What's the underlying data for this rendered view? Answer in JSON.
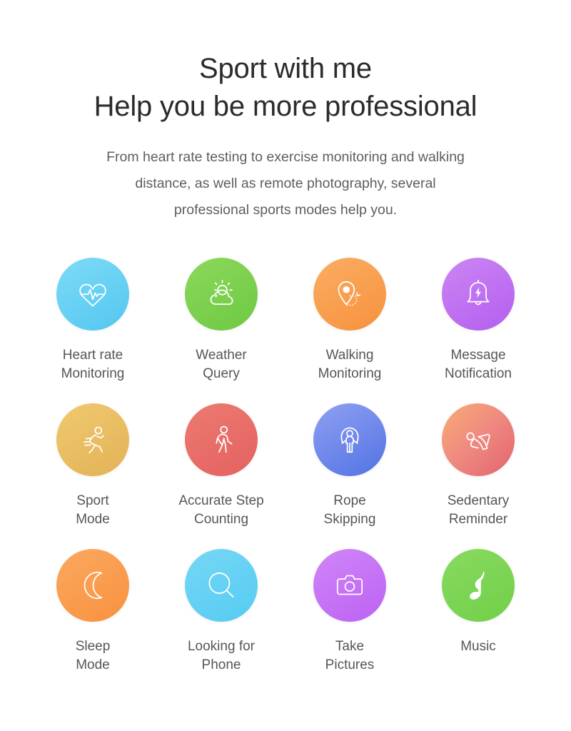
{
  "header": {
    "title_line1": "Sport with me",
    "title_line2": "Help you be more professional",
    "subtitle_line1": "From heart rate testing to exercise monitoring and walking",
    "subtitle_line2": "distance, as well as remote photography, several",
    "subtitle_line3": "professional sports modes help you."
  },
  "features": [
    {
      "icon": "heart-rate-icon",
      "label_line1": "Heart rate",
      "label_line2": "Monitoring",
      "color_start": "#7edbf7",
      "color_end": "#53c6f0"
    },
    {
      "icon": "sun-cloud-icon",
      "label_line1": "Weather",
      "label_line2": "Query",
      "color_start": "#8cd85c",
      "color_end": "#6ec942"
    },
    {
      "icon": "location-pin-path-icon",
      "label_line1": "Walking",
      "label_line2": "Monitoring",
      "color_start": "#fbad63",
      "color_end": "#f6923c"
    },
    {
      "icon": "bell-bolt-icon",
      "label_line1": "Message",
      "label_line2": "Notification",
      "color_start": "#cb86f2",
      "color_end": "#b45ef0"
    },
    {
      "icon": "running-person-icon",
      "label_line1": "Sport",
      "label_line2": "Mode",
      "color_start": "#f0c96f",
      "color_end": "#e3b257"
    },
    {
      "icon": "walking-person-icon",
      "label_line1": "Accurate Step",
      "label_line2": "Counting",
      "color_start": "#ec7b72",
      "color_end": "#e4615f"
    },
    {
      "icon": "jump-rope-person-icon",
      "label_line1": "Rope",
      "label_line2": "Skipping",
      "color_start": "#8fa0f1",
      "color_end": "#5273e4"
    },
    {
      "icon": "sit-up-person-icon",
      "label_line1": "Sedentary",
      "label_line2": "Reminder",
      "color_start": "#f7ad74",
      "color_end": "#e3636f"
    },
    {
      "icon": "crescent-moon-icon",
      "label_line1": "Sleep",
      "label_line2": "Mode",
      "color_start": "#fba860",
      "color_end": "#f8923f"
    },
    {
      "icon": "magnifier-icon",
      "label_line1": "Looking for",
      "label_line2": "Phone",
      "color_start": "#76d7f5",
      "color_end": "#56cbf2"
    },
    {
      "icon": "camera-icon",
      "label_line1": "Take",
      "label_line2": "Pictures",
      "color_start": "#d086f7",
      "color_end": "#bc62f3"
    },
    {
      "icon": "music-note-icon",
      "label_line1": "Music",
      "label_line2": "",
      "color_start": "#88da5f",
      "color_end": "#72cf49"
    }
  ],
  "theme": {
    "background": "#ffffff",
    "heading_color": "#2b2b2b",
    "body_text_color": "#5e5e5e",
    "caption_color": "#565656"
  }
}
